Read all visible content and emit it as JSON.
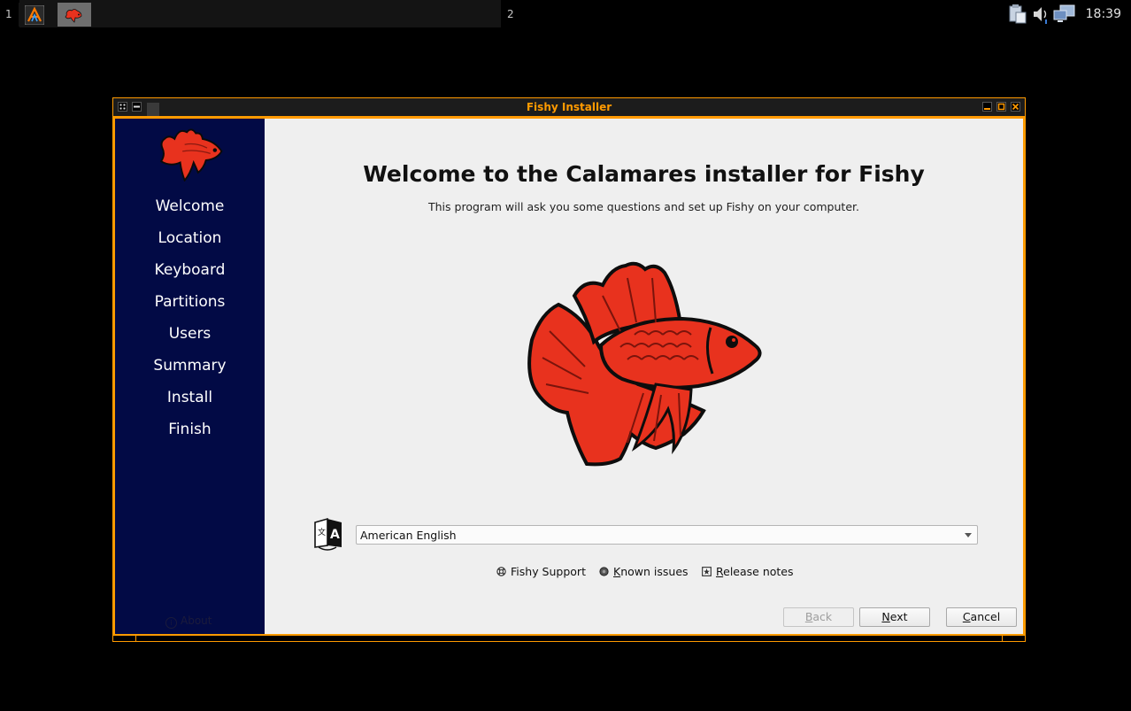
{
  "panel": {
    "workspace_1": "1",
    "workspace_2": "2",
    "clock": "18:39",
    "tasks": [
      {
        "name": "archcraft-icon"
      },
      {
        "name": "fishy-installer-icon",
        "active": true
      }
    ],
    "tray_icons": [
      "clipboard-icon",
      "volume-icon",
      "network-icon"
    ]
  },
  "window": {
    "title": "Fishy Installer",
    "border_color": "#ff9a00",
    "sidebar_color": "#020a45"
  },
  "sidebar": {
    "steps": [
      "Welcome",
      "Location",
      "Keyboard",
      "Partitions",
      "Users",
      "Summary",
      "Install",
      "Finish"
    ],
    "about_label": "About"
  },
  "main": {
    "headline": "Welcome to the Calamares installer for Fishy",
    "subline": "This program will ask you some questions and set up Fishy on your computer.",
    "language_selected": "American English",
    "links": {
      "support": "Fishy Support",
      "known_issues_prefix": "K",
      "known_issues_rest": "nown issues",
      "release_notes_prefix": "R",
      "release_notes_rest": "elease notes"
    }
  },
  "buttons": {
    "back_prefix": "B",
    "back_rest": "ack",
    "next_prefix": "N",
    "next_rest": "ext",
    "cancel_prefix": "C",
    "cancel_rest": "ancel"
  }
}
